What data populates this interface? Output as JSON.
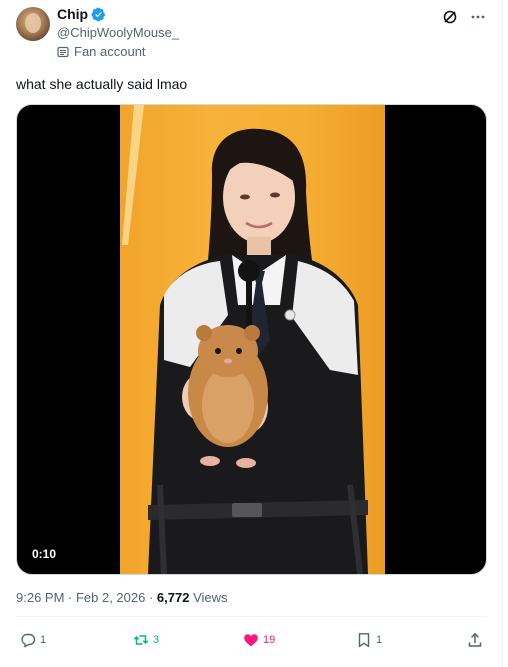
{
  "author": {
    "name": "Chip",
    "handle": "@ChipWoolyMouse_",
    "label": "Fan account"
  },
  "tweet": {
    "text": "what she actually said lmao"
  },
  "video": {
    "duration": "0:10"
  },
  "meta": {
    "datetime": "9:26 PM · Feb 2, 2026 · ",
    "views_count": "6,772",
    "views_label": " Views"
  },
  "actions": {
    "replies": "1",
    "reposts": "3",
    "likes": "19",
    "bookmarks": "1"
  },
  "colors": {
    "verified": "#1d9bf0",
    "repost_active": "#00ba7c",
    "like_active": "#f91880",
    "secondary_text": "#536471"
  },
  "icons": [
    "verified-badge-icon",
    "fan-account-icon",
    "grok-icon",
    "more-icon",
    "reply-icon",
    "repost-icon",
    "like-icon",
    "bookmark-icon",
    "share-icon"
  ]
}
